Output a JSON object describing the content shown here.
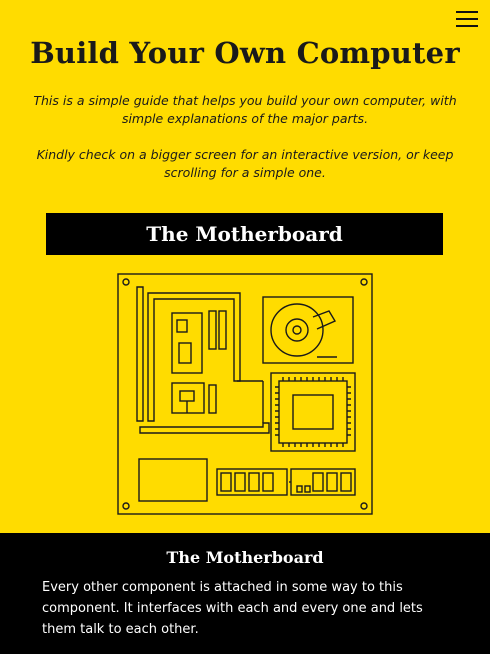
{
  "header": {
    "menu_icon": "hamburger-menu-icon",
    "title": "Build Your Own Computer"
  },
  "intro": {
    "line1": "This is a simple guide that helps you build your own computer, with simple explanations of the major parts.",
    "line2": "Kindly check on a bigger screen for an interactive version, or keep scrolling for a simple one."
  },
  "section": {
    "title": "The Motherboard",
    "illustration": "motherboard-illustration"
  },
  "info": {
    "title": "The Motherboard",
    "body": "Every other component is attached in some way to this component. It interfaces with each and every one and lets them talk to each other."
  },
  "colors": {
    "background": "#FFDC00",
    "dark": "#000000",
    "text_light": "#FFFFFF"
  }
}
